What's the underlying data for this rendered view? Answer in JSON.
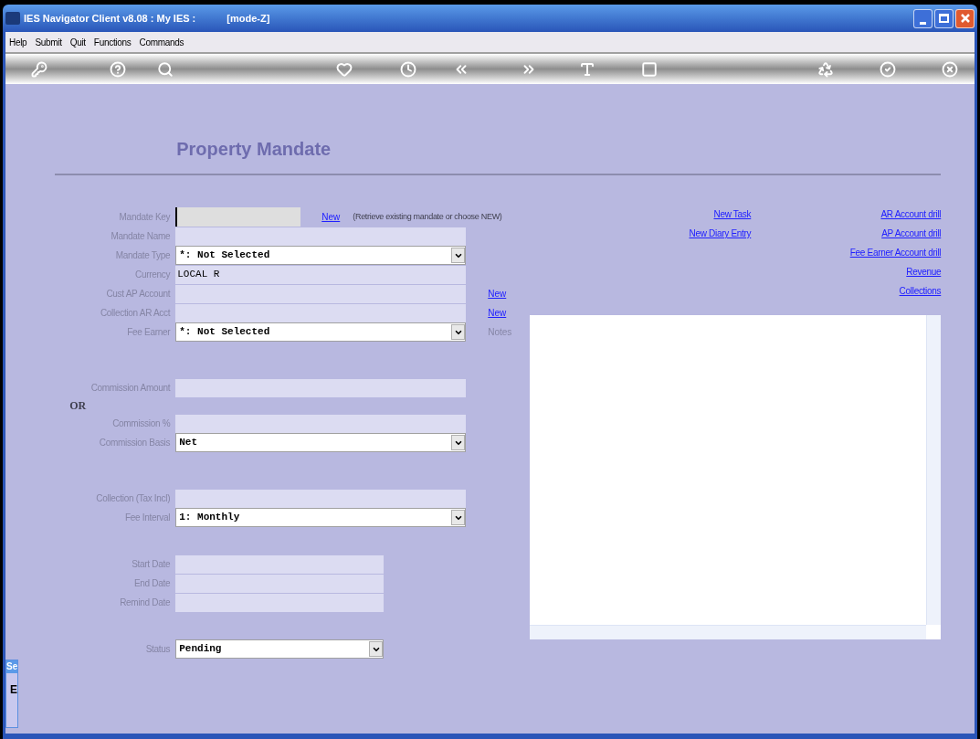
{
  "window": {
    "title": "IES Navigator Client v8.08 : My IES :",
    "mode": "[mode-Z]"
  },
  "menu": [
    "Help",
    "Submit",
    "Quit",
    "Functions",
    "Commands"
  ],
  "page_title": "Property Mandate",
  "form": [
    [
      {
        "kind": "key_field",
        "label": "Mandate Key",
        "link": "New",
        "hint": "(Retrieve existing mandate or choose NEW)"
      },
      {
        "kind": "text_field",
        "label": "Mandate Name"
      },
      {
        "kind": "select",
        "label": "Mandate Type",
        "value": "*: Not Selected"
      },
      {
        "kind": "display",
        "label": "Currency",
        "value": "LOCAL R"
      },
      {
        "kind": "text_field",
        "label": "Cust AP Account",
        "link": "New"
      },
      {
        "kind": "text_field",
        "label": "Collection AR Acct",
        "link": "New"
      },
      {
        "kind": "select",
        "label": "Fee Earner",
        "value": "*: Not Selected",
        "side_label": "Notes"
      }
    ],
    [
      {
        "kind": "text_field",
        "label": "Commission Amount"
      },
      {
        "kind": "or_label",
        "label": "OR"
      },
      {
        "kind": "text_field",
        "label": "Commission %"
      },
      {
        "kind": "select",
        "label": "Commission Basis",
        "value": "Net"
      }
    ],
    [
      {
        "kind": "text_field",
        "label": "Collection (Tax Incl)"
      },
      {
        "kind": "select",
        "label": "Fee Interval",
        "value": "1: Monthly"
      }
    ],
    [
      {
        "kind": "short_text_field",
        "label": "Start Date"
      },
      {
        "kind": "short_text_field",
        "label": "End Date"
      },
      {
        "kind": "short_text_field",
        "label": "Remind Date"
      }
    ],
    [
      {
        "kind": "short_select",
        "label": "Status",
        "value": "Pending"
      }
    ]
  ],
  "task_links": [
    "New Task",
    "New Diary Entry"
  ],
  "account_links": [
    "AR Account drill",
    "AP Account drill",
    "Fee Earner Account drill",
    "Revenue",
    "Collections"
  ],
  "side_panel": {
    "title": "Se",
    "glyph": "E"
  }
}
